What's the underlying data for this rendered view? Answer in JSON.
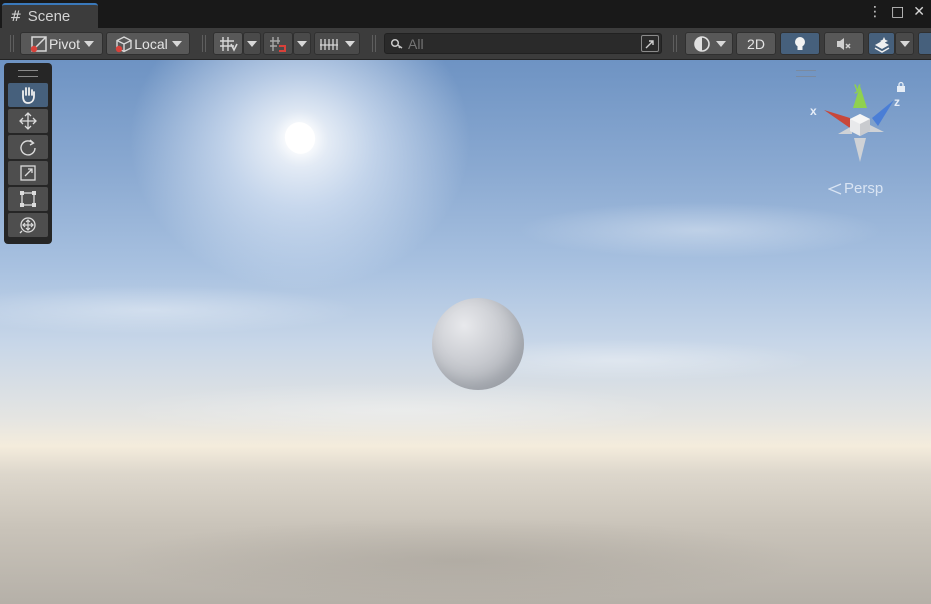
{
  "tab": {
    "title": "Scene",
    "icon": "grid-icon"
  },
  "window_controls": {
    "menu": "⋮",
    "maximize": "□",
    "close": "✕"
  },
  "toolbar": {
    "pivot_label": "Pivot",
    "local_label": "Local",
    "search_placeholder": "All",
    "view_2d_label": "2D"
  },
  "tools": [
    "hand-tool",
    "move-tool",
    "rotate-tool",
    "scale-tool",
    "rect-tool",
    "transform-tool"
  ],
  "gizmo": {
    "x": "x",
    "y": "y",
    "z": "z",
    "projection": "Persp"
  },
  "colors": {
    "accent": "#3a79bb",
    "selected": "#46607c",
    "toolbar": "#3c3c3c",
    "x_axis": "#c8473a",
    "y_axis": "#8fd14f",
    "z_axis": "#4a7ed6"
  }
}
